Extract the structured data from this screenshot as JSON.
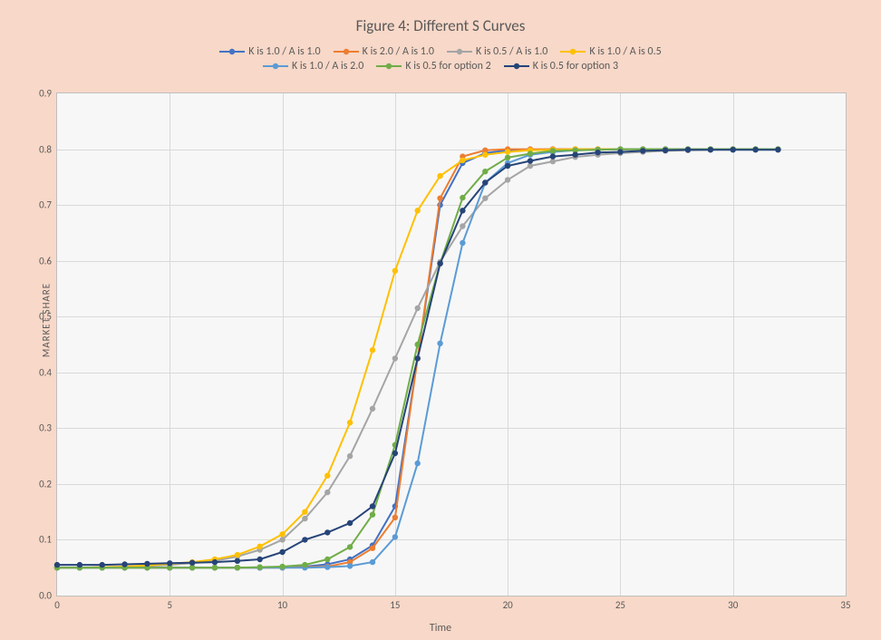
{
  "title": "Figure 4: Different S Curves",
  "xlabel": "Time",
  "ylabel": "MARKET SHARE",
  "legend": [
    {
      "name": "K is 1.0 /  A is 1.0",
      "color": "#4472C4"
    },
    {
      "name": "K is 2.0 /  A is 1.0",
      "color": "#ED7D31"
    },
    {
      "name": "K is 0.5 /  A is 1.0",
      "color": "#A5A5A5"
    },
    {
      "name": "K is 1.0 /  A is 0.5",
      "color": "#FFC000"
    },
    {
      "name": "K is 1.0 /  A is 2.0",
      "color": "#5B9BD5"
    },
    {
      "name": "K is 0.5 for option 2",
      "color": "#70AD47"
    },
    {
      "name": "K is 0.5 for option 3",
      "color": "#264478"
    }
  ],
  "chart_data": {
    "type": "line",
    "title": "Figure 4: Different S Curves",
    "xlabel": "Time",
    "ylabel": "MARKET SHARE",
    "xlim": [
      0,
      35
    ],
    "ylim": [
      0.0,
      0.9
    ],
    "xticks": [
      0,
      5,
      10,
      15,
      20,
      25,
      30,
      35
    ],
    "yticks": [
      0.0,
      0.1,
      0.2,
      0.3,
      0.4,
      0.5,
      0.6,
      0.7,
      0.8,
      0.9
    ],
    "x": [
      0,
      1,
      2,
      3,
      4,
      5,
      6,
      7,
      8,
      9,
      10,
      11,
      12,
      13,
      14,
      15,
      16,
      17,
      18,
      19,
      20,
      21,
      22,
      23,
      24,
      25,
      26,
      27,
      28,
      29,
      30,
      31,
      32
    ],
    "series": [
      {
        "name": "K is 1.0 /  A is 1.0",
        "color": "#4472C4",
        "values": [
          0.05,
          0.05,
          0.05,
          0.05,
          0.05,
          0.05,
          0.05,
          0.05,
          0.05,
          0.05,
          0.051,
          0.052,
          0.056,
          0.065,
          0.09,
          0.16,
          0.425,
          0.7,
          0.775,
          0.793,
          0.798,
          0.799,
          0.8,
          0.8,
          0.8,
          0.8,
          0.8,
          0.8,
          0.8,
          0.8,
          0.8,
          0.8,
          0.8
        ]
      },
      {
        "name": "K is 2.0 /  A is 1.0",
        "color": "#ED7D31",
        "values": [
          0.05,
          0.05,
          0.05,
          0.05,
          0.05,
          0.05,
          0.05,
          0.05,
          0.05,
          0.05,
          0.05,
          0.051,
          0.052,
          0.06,
          0.085,
          0.14,
          0.425,
          0.712,
          0.787,
          0.798,
          0.8,
          0.8,
          0.8,
          0.8,
          0.8,
          0.8,
          0.8,
          0.8,
          0.8,
          0.8,
          0.8,
          0.8,
          0.8
        ]
      },
      {
        "name": "K is 0.5 /  A is 1.0",
        "color": "#A5A5A5",
        "values": [
          0.05,
          0.05,
          0.051,
          0.052,
          0.053,
          0.055,
          0.058,
          0.062,
          0.07,
          0.082,
          0.1,
          0.138,
          0.185,
          0.25,
          0.335,
          0.425,
          0.515,
          0.598,
          0.662,
          0.712,
          0.745,
          0.77,
          0.778,
          0.786,
          0.79,
          0.793,
          0.795,
          0.797,
          0.798,
          0.799,
          0.8,
          0.8,
          0.8
        ]
      },
      {
        "name": "K is 1.0 /  A is 0.5",
        "color": "#FFC000",
        "values": [
          0.05,
          0.05,
          0.051,
          0.052,
          0.054,
          0.057,
          0.06,
          0.065,
          0.073,
          0.088,
          0.11,
          0.15,
          0.215,
          0.31,
          0.44,
          0.582,
          0.69,
          0.752,
          0.78,
          0.79,
          0.795,
          0.798,
          0.799,
          0.8,
          0.8,
          0.8,
          0.8,
          0.8,
          0.8,
          0.8,
          0.8,
          0.8,
          0.8
        ]
      },
      {
        "name": "K is 1.0 /  A is 2.0",
        "color": "#5B9BD5",
        "values": [
          0.05,
          0.05,
          0.05,
          0.05,
          0.05,
          0.05,
          0.05,
          0.05,
          0.05,
          0.05,
          0.05,
          0.05,
          0.051,
          0.053,
          0.06,
          0.105,
          0.237,
          0.452,
          0.632,
          0.74,
          0.775,
          0.79,
          0.795,
          0.798,
          0.799,
          0.8,
          0.8,
          0.8,
          0.8,
          0.8,
          0.8,
          0.8,
          0.8
        ]
      },
      {
        "name": "K is 0.5 for option 2",
        "color": "#70AD47",
        "values": [
          0.05,
          0.05,
          0.05,
          0.05,
          0.05,
          0.05,
          0.05,
          0.05,
          0.05,
          0.051,
          0.052,
          0.055,
          0.065,
          0.087,
          0.145,
          0.27,
          0.45,
          0.595,
          0.713,
          0.76,
          0.785,
          0.792,
          0.797,
          0.798,
          0.799,
          0.8,
          0.8,
          0.8,
          0.8,
          0.8,
          0.8,
          0.8,
          0.8
        ]
      },
      {
        "name": "K is 0.5 for option 3",
        "color": "#264478",
        "values": [
          0.055,
          0.055,
          0.055,
          0.056,
          0.057,
          0.058,
          0.059,
          0.06,
          0.062,
          0.065,
          0.078,
          0.1,
          0.113,
          0.13,
          0.16,
          0.255,
          0.425,
          0.595,
          0.69,
          0.74,
          0.77,
          0.779,
          0.787,
          0.79,
          0.794,
          0.795,
          0.797,
          0.798,
          0.799,
          0.799,
          0.799,
          0.799,
          0.799
        ]
      }
    ]
  }
}
